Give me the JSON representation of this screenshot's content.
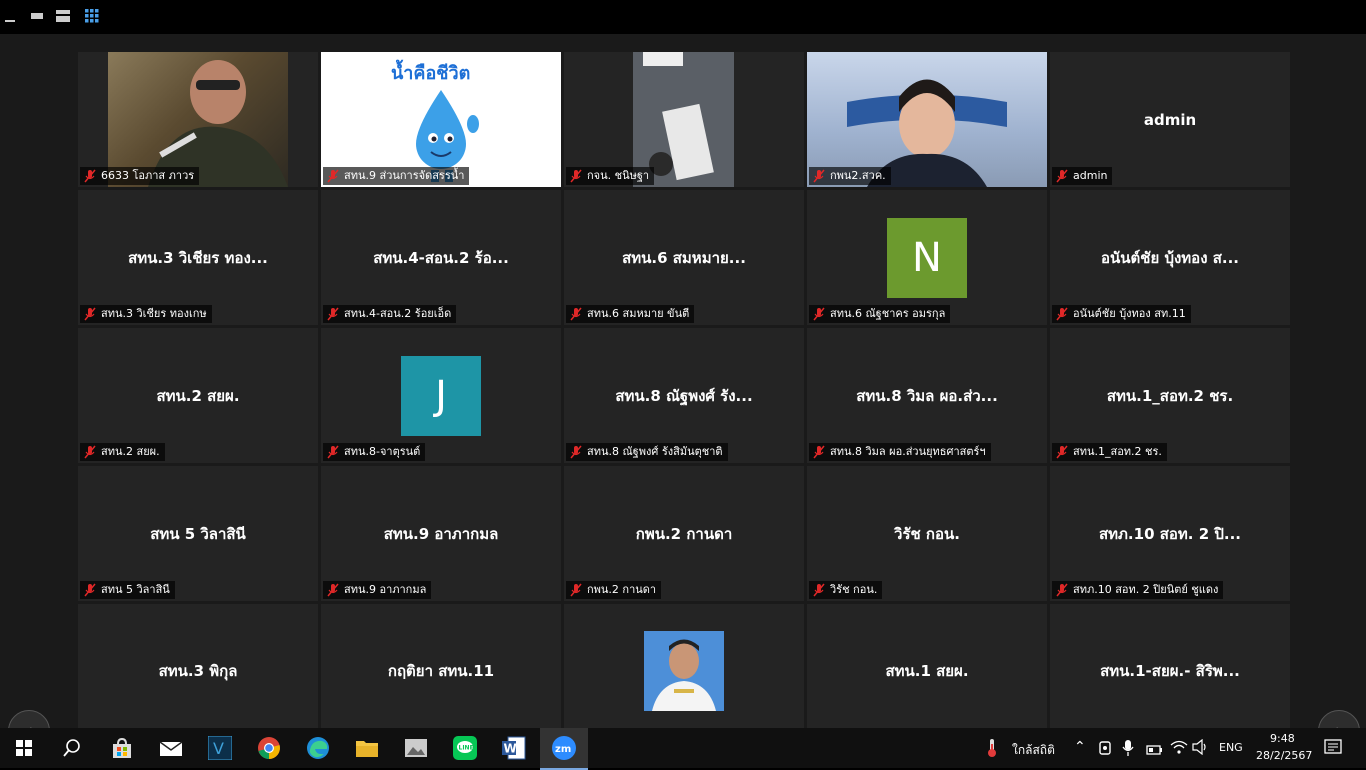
{
  "window": {
    "view_controls": [
      "minimize",
      "window-mode-1",
      "window-mode-2",
      "gallery-view"
    ]
  },
  "tiles": [
    {
      "label": "6633 โอภาส ภาวร",
      "center": "",
      "type": "video"
    },
    {
      "label": "สทน.9 ส่วนการจัดสรรน้ำ",
      "center": "",
      "type": "video",
      "image_text": "น้ำคือชีวิต"
    },
    {
      "label": "กจน. ชนิษฐา",
      "center": "",
      "type": "video"
    },
    {
      "label": "กพน2.สวค.",
      "center": "",
      "type": "video"
    },
    {
      "label": "admin",
      "center": "admin",
      "type": "name"
    },
    {
      "label": "สทน.3 วิเชียร ทองเกษ",
      "center": "สทน.3 วิเชียร ทอง...",
      "type": "name"
    },
    {
      "label": "สทน.4-สอน.2 ร้อยเอ็ด",
      "center": "สทน.4-สอน.2 ร้อ...",
      "type": "name"
    },
    {
      "label": "สทน.6 สมหมาย  ขันตี",
      "center": "สทน.6 สมหมาย...",
      "type": "name"
    },
    {
      "label": "สทน.6 ณัฐชาคร อมรกุล",
      "center": "",
      "type": "avatar",
      "letter": "N",
      "color": "#6c9a2e"
    },
    {
      "label": "อนันต์ชัย บุ้งทอง สท.11",
      "center": "อนันต์ชัย บุ้งทอง ส...",
      "type": "name"
    },
    {
      "label": "สทน.2 สยผ.",
      "center": "สทน.2 สยผ.",
      "type": "name"
    },
    {
      "label": "สทน.8-จาตุรนต์",
      "center": "",
      "type": "avatar",
      "letter": "J",
      "color": "#1e95a6"
    },
    {
      "label": "สทน.8 ณัฐพงศ์ รังสิมันตุชาติ",
      "center": "สทน.8 ณัฐพงศ์ รัง...",
      "type": "name"
    },
    {
      "label": "สทน.8 วิมล ผอ.ส่วนยุทธศาสตร์ฯ",
      "center": "สทน.8 วิมล ผอ.ส่ว...",
      "type": "name"
    },
    {
      "label": "สทน.1_สอท.2 ชร.",
      "center": "สทน.1_สอท.2 ชร.",
      "type": "name"
    },
    {
      "label": "สทน 5 วิลาสินี",
      "center": "สทน 5 วิลาสินี",
      "type": "name"
    },
    {
      "label": "สทน.9 อาภากมล",
      "center": "สทน.9 อาภากมล",
      "type": "name"
    },
    {
      "label": "กพน.2 กานดา",
      "center": "กพน.2 กานดา",
      "type": "name"
    },
    {
      "label": "วิรัช กอน.",
      "center": "วิรัช กอน.",
      "type": "name"
    },
    {
      "label": "สทภ.10 สอท. 2 ปิยนิตย์ ชูแดง",
      "center": "สทภ.10 สอท. 2 ปิ...",
      "type": "name"
    },
    {
      "label": "",
      "center": "สทน.3 พิกุล",
      "type": "name"
    },
    {
      "label": "",
      "center": "กฤติยา สทน.11",
      "type": "name"
    },
    {
      "label": "",
      "center": "",
      "type": "photo"
    },
    {
      "label": "",
      "center": "สทน.1 สยผ.",
      "type": "name"
    },
    {
      "label": "",
      "center": "สทน.1-สยผ.- สิริพ...",
      "type": "name"
    }
  ],
  "nav": {
    "prev": "‹",
    "next": "›"
  },
  "taskbar": {
    "apps": [
      "start",
      "search",
      "store",
      "mail",
      "veeam",
      "chrome",
      "edge",
      "explorer",
      "photos",
      "line",
      "word",
      "zoom"
    ],
    "weather": "ใกล้สถิติ",
    "lang": "ENG",
    "time": "9:48",
    "date": "28/2/2567"
  }
}
